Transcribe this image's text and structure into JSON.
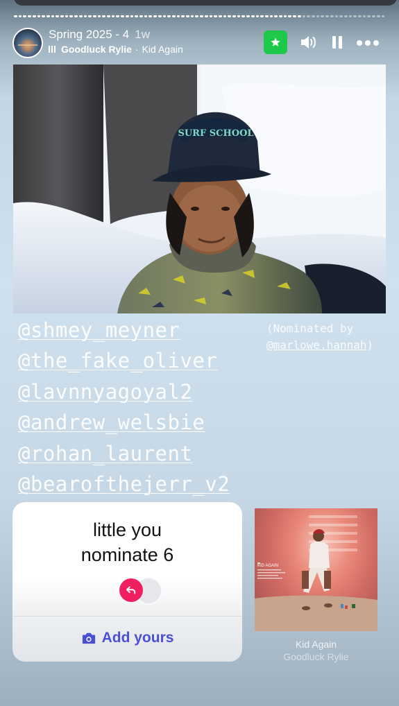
{
  "story": {
    "title": "Spring 2025 - 4",
    "time_ago": "1w",
    "progress_segments": 80,
    "progress_completed": 62
  },
  "music": {
    "artist": "Goodluck Rylie",
    "separator": "·",
    "song": "Kid Again"
  },
  "icons": {
    "avatar": "profile-avatar",
    "star": "star-icon",
    "sound": "speaker-icon",
    "pause": "pause-icon",
    "more": "more-icon",
    "reply": "reply-arrow-icon",
    "camera": "camera-icon"
  },
  "colors": {
    "star_bg": "#1ec94a",
    "reply_bg": "#ef1f62",
    "add_yours": "#4b4fd1"
  },
  "mentions": [
    "@shmey_meyner",
    "@the_fake_oliver",
    "@lavnnyagoyal2",
    "@andrew_welsbie",
    "@rohan_laurent",
    "@bearofthejerr_v2"
  ],
  "nomination": {
    "prefix": "(Nominated by",
    "handle": "@marlowe.hannah",
    "suffix": ")"
  },
  "add_yours_card": {
    "prompt_line1": "little you",
    "prompt_line2": "nominate 6",
    "button_label": "Add yours"
  },
  "album": {
    "title": "Kid Again",
    "artist": "Goodluck Rylie",
    "cover_text": "KID AGAIN"
  }
}
